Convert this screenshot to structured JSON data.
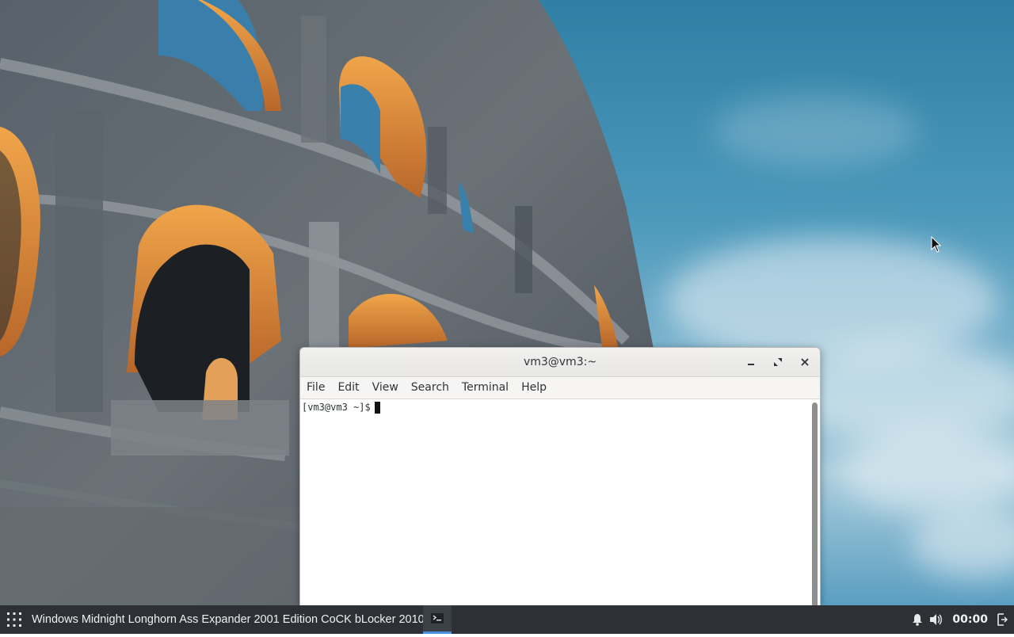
{
  "desktop": {
    "wallpaper": "colosseum-photo"
  },
  "terminal_window": {
    "title": "vm3@vm3:~",
    "menu": [
      "File",
      "Edit",
      "View",
      "Search",
      "Terminal",
      "Help"
    ],
    "prompt": "[vm3@vm3 ~]$",
    "controls": {
      "minimize_icon": "minimize-icon",
      "maximize_icon": "maximize-icon",
      "close_icon": "close-icon"
    }
  },
  "taskbar": {
    "apps_icon": "grid-icon",
    "active_window_title": "Windows Midnight Longhorn Ass Expander 2001 Edition CoCK bLocker 2010",
    "task_icon": "terminal-icon",
    "tray": {
      "notifications_icon": "bell-icon",
      "volume_icon": "volume-icon",
      "clock": "00:00",
      "logout_icon": "logout-icon"
    }
  },
  "colors": {
    "taskbar_bg": "#2d3136",
    "accent": "#4a90d9",
    "window_bg": "#ffffff"
  }
}
